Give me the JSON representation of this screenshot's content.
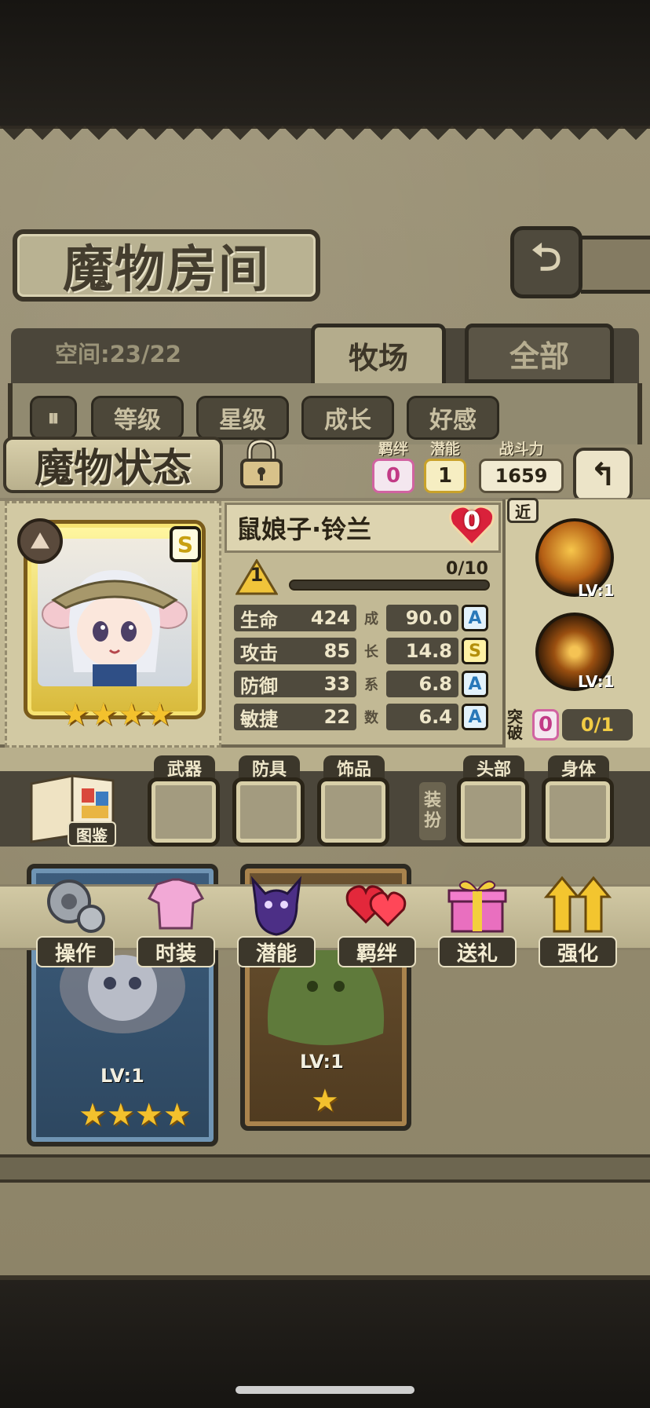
{
  "header": {
    "title": "魔物房间",
    "back_icon": "return-arrow-icon"
  },
  "tabs": {
    "space_label": "空间:23/22",
    "items": [
      {
        "label": "牧场",
        "active": true
      },
      {
        "label": "全部",
        "active": false
      }
    ]
  },
  "sort": {
    "toggle_icon": "pause-sort-icon",
    "buttons": [
      "等级",
      "星级",
      "成长",
      "好感"
    ]
  },
  "status": {
    "title": "魔物状态",
    "lock_icon": "padlock-icon",
    "bond_label": "羁绊",
    "bond_value": "0",
    "potential_label": "潜能",
    "potential_value": "1",
    "power_label": "战斗力",
    "power_value": "1659",
    "return_icon": "return-arrow-icon"
  },
  "monster": {
    "name": "鼠娘子·铃兰",
    "rank": "S",
    "class_icon": "mountain-class-icon",
    "stars": 4,
    "affection": "0",
    "level": "1",
    "exp": "0/10",
    "exp_fraction": 0,
    "stats": [
      {
        "name": "生命",
        "value": "424",
        "growth": "90.0",
        "grade": "A"
      },
      {
        "name": "攻击",
        "value": "85",
        "growth": "14.8",
        "grade": "S"
      },
      {
        "name": "防御",
        "value": "33",
        "growth": "6.8",
        "grade": "A"
      },
      {
        "name": "敏捷",
        "value": "22",
        "growth": "6.4",
        "grade": "A"
      }
    ],
    "growth_marks": [
      "成",
      "长",
      "系",
      "数"
    ],
    "range": "近",
    "skills": [
      {
        "name": "skill-1",
        "level": "LV:1"
      },
      {
        "name": "skill-2",
        "level": "LV:1"
      }
    ],
    "breakthrough_label": "突破",
    "breakthrough_value": "0",
    "breakthrough_progress": "0/1"
  },
  "equipment": {
    "book_label": "图鉴",
    "slots_left": [
      "武器",
      "防具",
      "饰品"
    ],
    "dress_label": "装扮",
    "slots_right": [
      "头部",
      "身体"
    ]
  },
  "actions": [
    {
      "label": "操作",
      "icon": "gear-icon"
    },
    {
      "label": "时装",
      "icon": "outfit-icon"
    },
    {
      "label": "潜能",
      "icon": "shadow-potential-icon"
    },
    {
      "label": "羁绊",
      "icon": "hearts-icon"
    },
    {
      "label": "送礼",
      "icon": "gift-icon"
    },
    {
      "label": "强化",
      "icon": "upgrade-arrows-icon"
    }
  ],
  "list_cards": [
    {
      "level": "LV:1",
      "stars": 4
    },
    {
      "level": "LV:1",
      "stars": 1
    }
  ]
}
